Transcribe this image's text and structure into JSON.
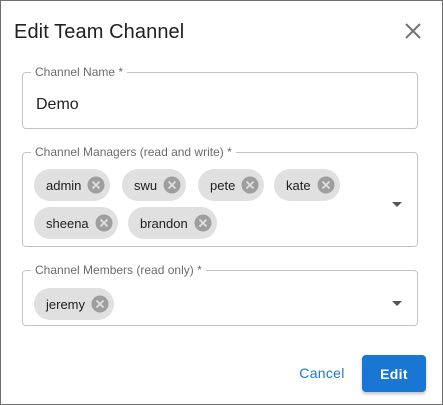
{
  "dialog": {
    "title": "Edit Team Channel",
    "close_icon": "close-icon"
  },
  "channel_name": {
    "label": "Channel Name *",
    "value": "Demo"
  },
  "channel_managers": {
    "label": "Channel Managers (read and write) *",
    "chips": [
      "admin",
      "swu",
      "pete",
      "kate",
      "sheena",
      "brandon"
    ]
  },
  "channel_members": {
    "label": "Channel Members (read only) *",
    "chips": [
      "jeremy"
    ]
  },
  "actions": {
    "cancel_label": "Cancel",
    "edit_label": "Edit"
  },
  "colors": {
    "primary": "#1976d2",
    "chip_bg": "#e0e0e0",
    "border": "#c4c4c4"
  }
}
